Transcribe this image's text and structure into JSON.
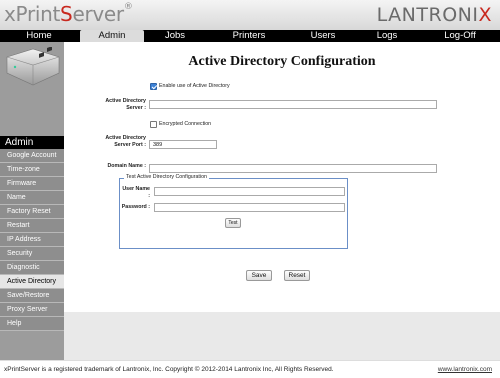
{
  "header": {
    "brand_prefix": "xPrint",
    "brand_suffix": "Server",
    "brand_reg": "®",
    "vendor_main": "LANTRONI",
    "vendor_x": "X"
  },
  "topnav": {
    "items": [
      {
        "label": "Home"
      },
      {
        "label": "Admin"
      },
      {
        "label": "Jobs"
      },
      {
        "label": "Printers"
      },
      {
        "label": "Users"
      },
      {
        "label": "Logs"
      },
      {
        "label": "Log-Off"
      }
    ],
    "active": "Admin"
  },
  "sidebar": {
    "header": "Admin",
    "items": [
      {
        "label": "Google Account"
      },
      {
        "label": "Time-zone"
      },
      {
        "label": "Firmware"
      },
      {
        "label": "Name"
      },
      {
        "label": "Factory Reset"
      },
      {
        "label": "Restart"
      },
      {
        "label": "IP Address"
      },
      {
        "label": "Security"
      },
      {
        "label": "Diagnostic"
      },
      {
        "label": "Active Directory"
      },
      {
        "label": "Save/Restore"
      },
      {
        "label": "Proxy Server"
      },
      {
        "label": "Help"
      }
    ],
    "active": "Active Directory"
  },
  "form": {
    "title": "Active Directory Configuration",
    "enable_label": "Enable use of Active Directory",
    "enable_checked": true,
    "server_label": "Active Directory Server :",
    "server_value": "",
    "encrypted_label": "Encrypted Connection",
    "encrypted_checked": false,
    "port_label": "Active Directory Server Port :",
    "port_value": "389",
    "domain_label": "Domain Name :",
    "domain_value": "",
    "test_legend": "Test Active Directory Configuration",
    "user_label": "User Name :",
    "user_value": "",
    "password_label": "Password :",
    "password_value": "",
    "test_button": "Test",
    "save_button": "Save",
    "reset_button": "Reset"
  },
  "footer": {
    "text": "xPrintServer is a registered trademark of Lantronix, Inc. Copyright © 2012-2014 Lantronix Inc, All Rights Reserved.",
    "link": "www.lantronix.com"
  }
}
